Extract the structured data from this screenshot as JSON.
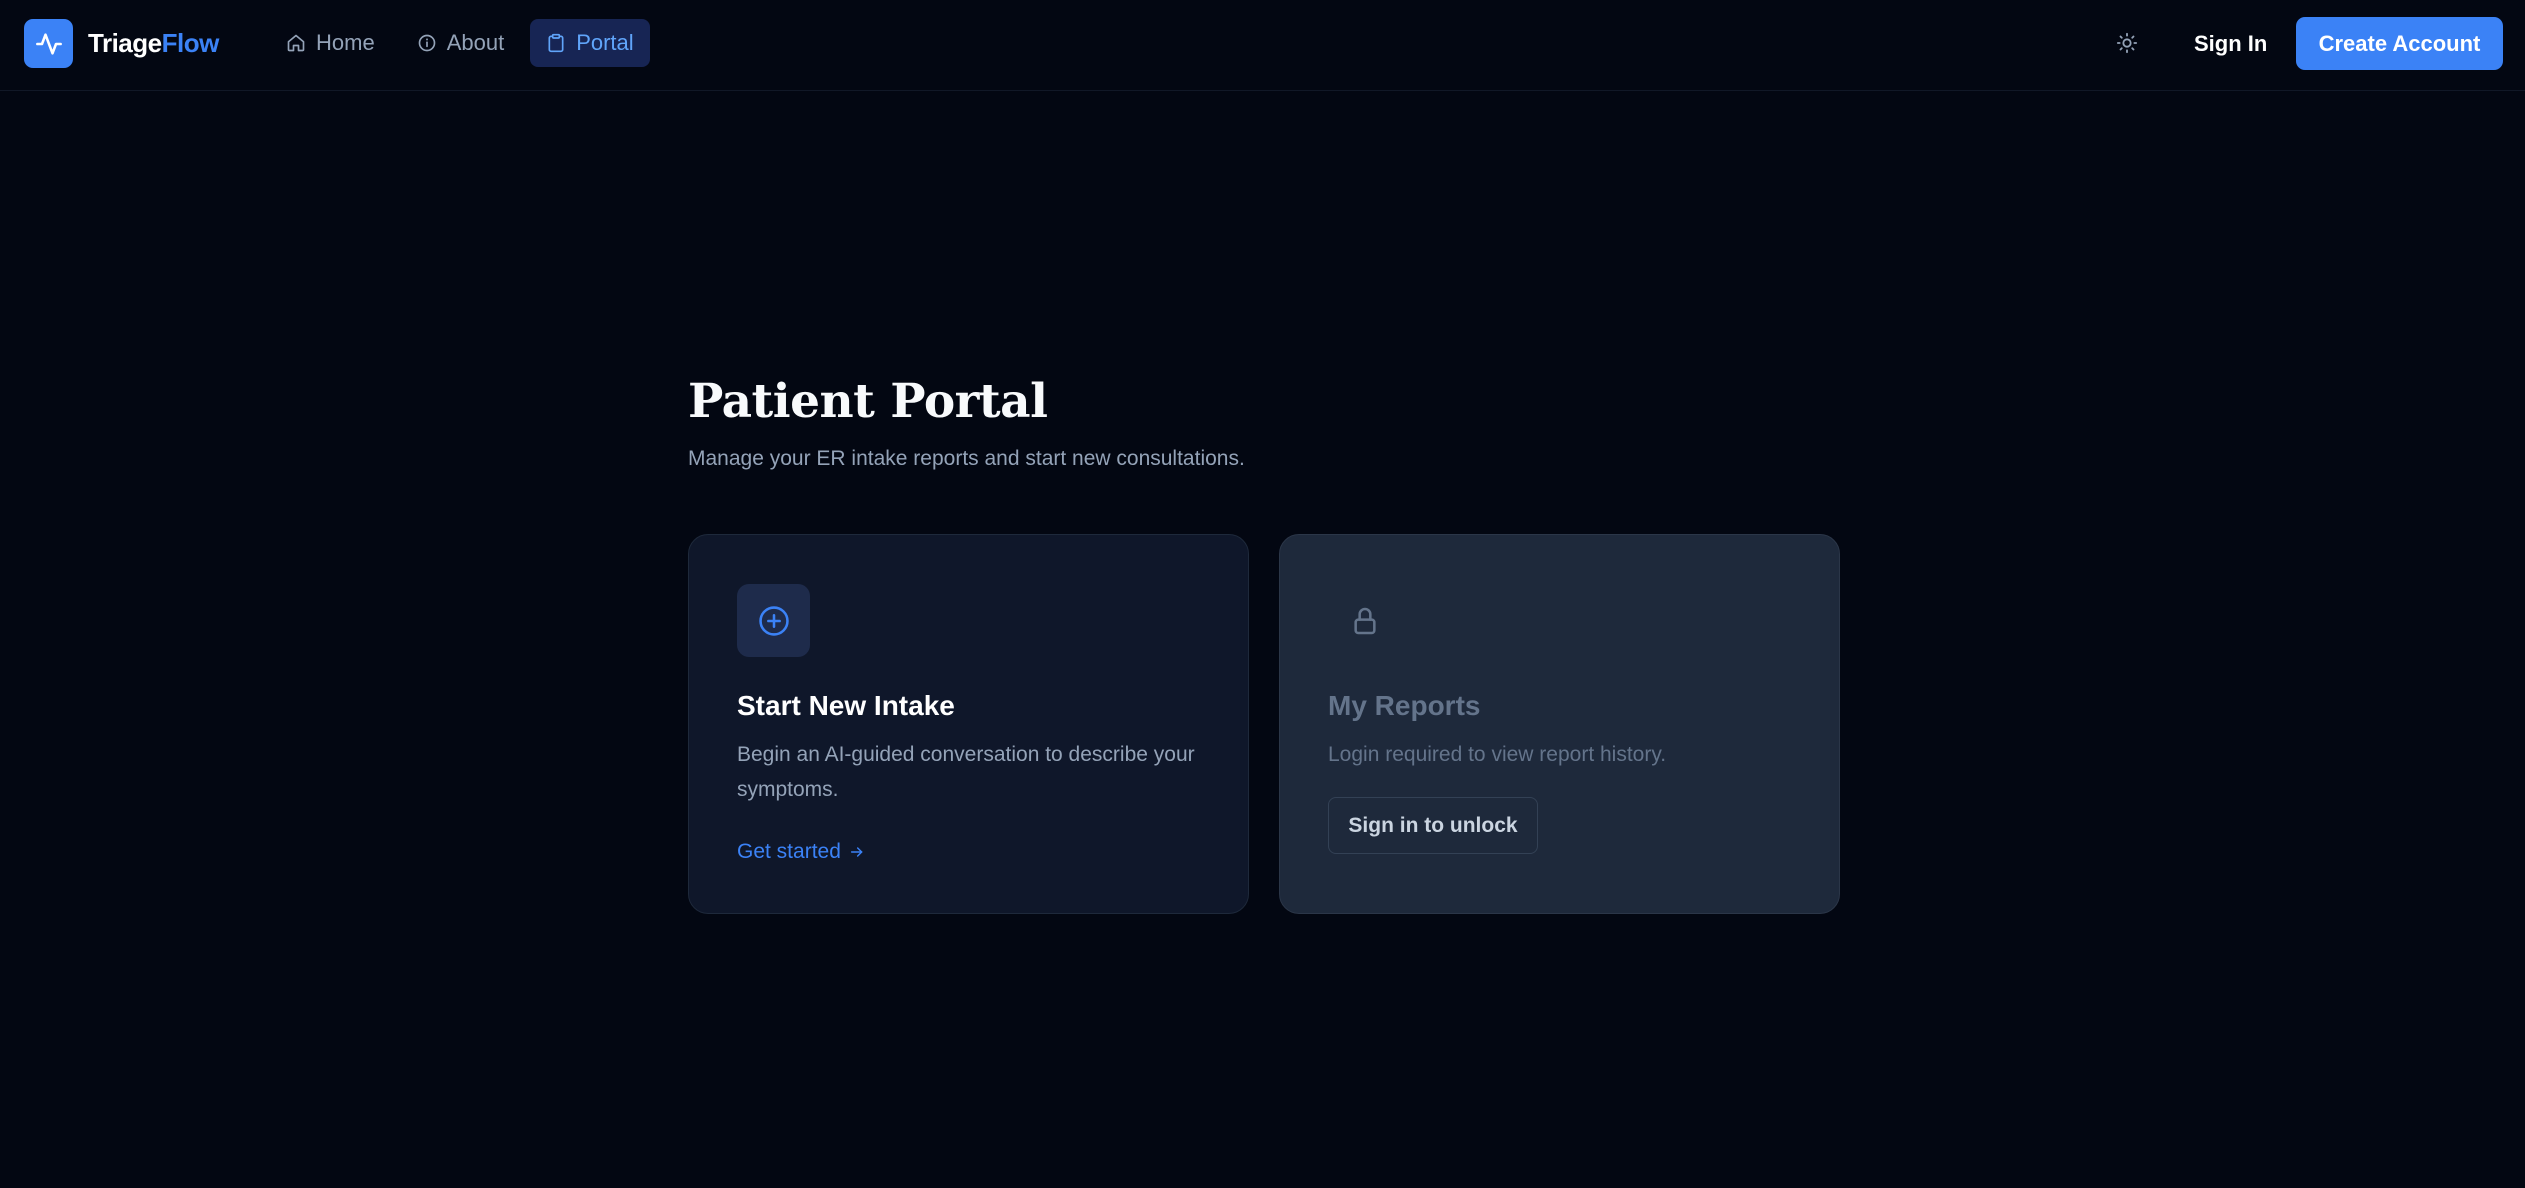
{
  "header": {
    "brand": {
      "name_part1": "Triage",
      "name_part2": "Flow",
      "logo_icon": "activity-pulse-icon"
    },
    "nav": [
      {
        "label": "Home",
        "icon": "home-icon"
      },
      {
        "label": "About",
        "icon": "info-icon"
      },
      {
        "label": "Portal",
        "icon": "clipboard-icon",
        "active": true
      }
    ],
    "theme_toggle_icon": "sun-icon",
    "sign_in_label": "Sign In",
    "create_account_label": "Create Account"
  },
  "main": {
    "title": "Patient Portal",
    "subtitle": "Manage your ER intake reports and start new consultations.",
    "cards": {
      "intake": {
        "icon": "plus-circle-icon",
        "title": "Start New Intake",
        "description": "Begin an AI-guided conversation to describe your symptoms.",
        "link_label": "Get started",
        "link_icon": "arrow-right-icon"
      },
      "reports": {
        "icon": "lock-icon",
        "title": "My Reports",
        "description": "Login required to view report history.",
        "button_label": "Sign in to unlock",
        "locked": true
      }
    }
  },
  "colors": {
    "background": "#030712",
    "accent": "#3b82f6",
    "card_bg": "#0f172a",
    "card_locked_bg": "#1e293b",
    "muted_text": "#94a3b8"
  }
}
